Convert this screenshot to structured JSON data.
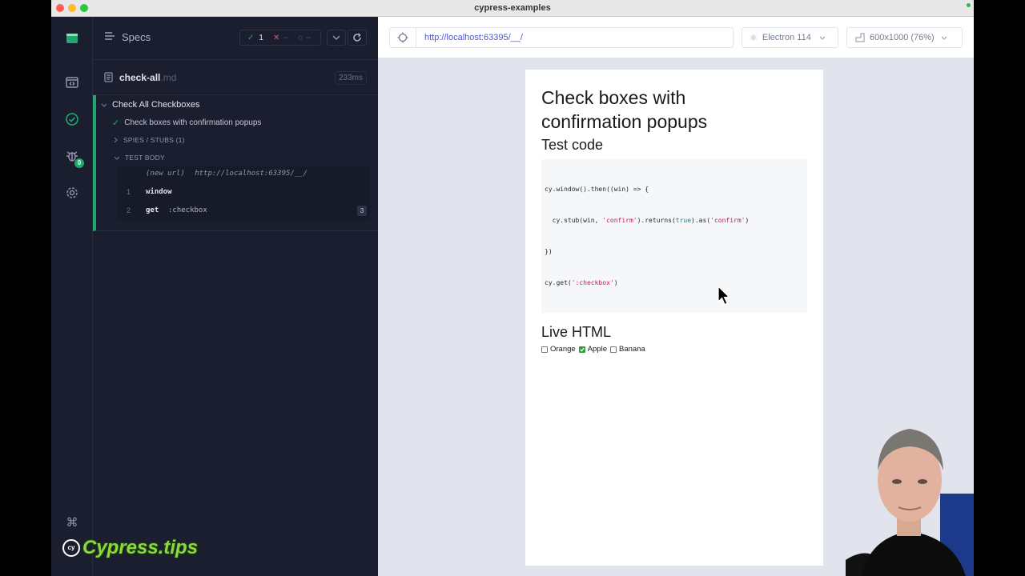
{
  "window": {
    "title": "cypress-examples"
  },
  "reporter": {
    "specs_label": "Specs",
    "stats": {
      "passed": "1",
      "failed": "--",
      "pending": "--"
    },
    "spec": {
      "name": "check-all",
      "ext": ".md",
      "duration": "233ms"
    },
    "suite_title": "Check All Checkboxes",
    "test_title": "Check boxes with confirmation popups",
    "spies_label": "SPIES / STUBS (1)",
    "body_label": "TEST BODY",
    "new_url": {
      "label": "(new url)",
      "value": "http://localhost:63395/__/"
    },
    "commands": [
      {
        "num": "1",
        "name": "window",
        "arg": "",
        "badge": ""
      },
      {
        "num": "2",
        "name": "get",
        "arg": ":checkbox",
        "badge": "3"
      }
    ],
    "bug_badge": "0"
  },
  "aut": {
    "url": "http://localhost:63395/__/",
    "browser": "Electron 114",
    "viewport": "600x1000 (76%)"
  },
  "page": {
    "title": "Check boxes with confirmation popups",
    "test_code_heading": "Test code",
    "code": {
      "l1": "cy.window().then((win) => {",
      "l2a": "  cy.stub(win, ",
      "l2b": "'confirm'",
      "l2c": ").returns(",
      "l2d": "true",
      "l2e": ").as(",
      "l2f": "'confirm'",
      "l2g": ")",
      "l3": "})",
      "l4a": "cy.get(",
      "l4b": "':checkbox'",
      "l4c": ")"
    },
    "live_heading": "Live HTML",
    "checkboxes": [
      {
        "label": "Orange",
        "checked": false
      },
      {
        "label": "Apple",
        "checked": true
      },
      {
        "label": "Banana",
        "checked": false
      }
    ]
  },
  "branding": {
    "watermark": "Cypress.tips"
  },
  "colors": {
    "accent_green": "#1fa971",
    "sidebar_bg": "#1b1e2e",
    "code_string": "#c2185b"
  }
}
